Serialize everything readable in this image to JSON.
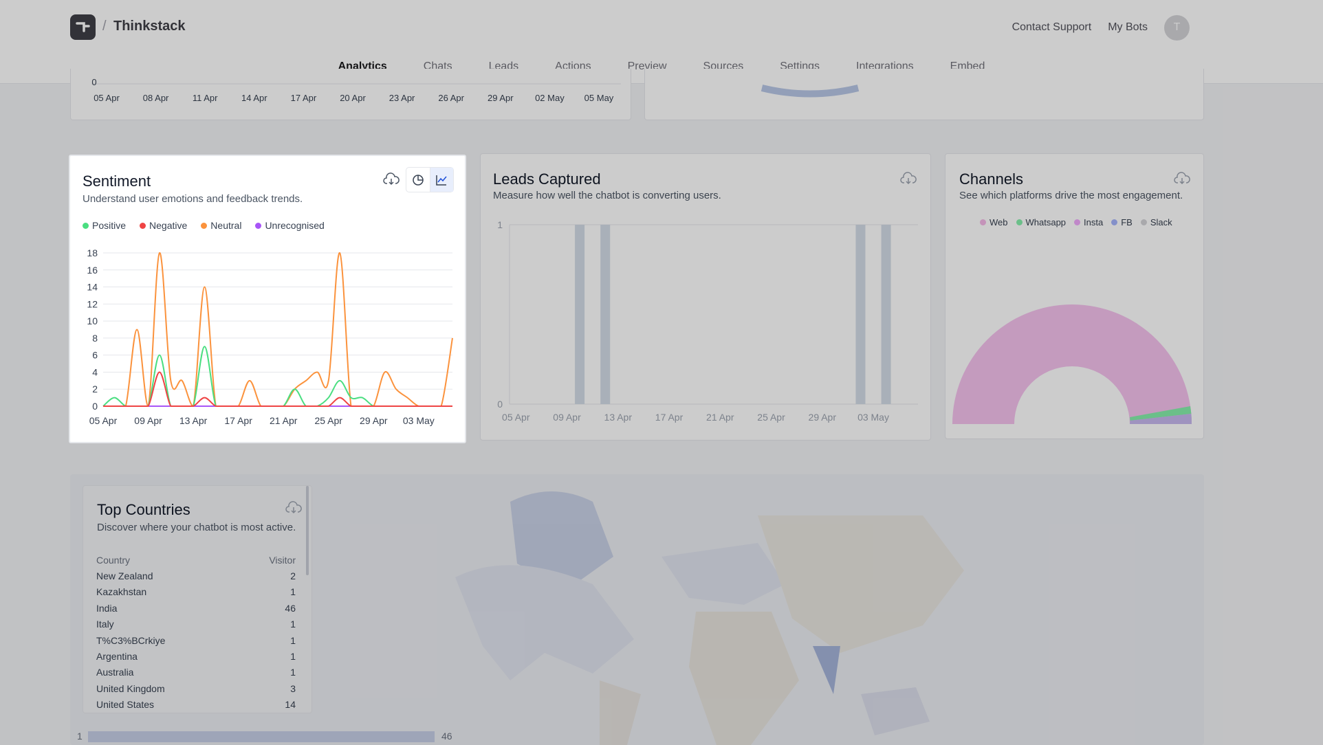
{
  "header": {
    "brand": "Thinkstack",
    "separator": "/",
    "contact_support": "Contact Support",
    "my_bots": "My Bots",
    "avatar_initial": "T"
  },
  "tabs": [
    {
      "label": "Analytics",
      "active": true
    },
    {
      "label": "Chats"
    },
    {
      "label": "Leads"
    },
    {
      "label": "Actions"
    },
    {
      "label": "Preview"
    },
    {
      "label": "Sources"
    },
    {
      "label": "Settings"
    },
    {
      "label": "Integrations"
    },
    {
      "label": "Embed"
    }
  ],
  "top_chart": {
    "y_zero": "0",
    "x_ticks": [
      "05 Apr",
      "08 Apr",
      "11 Apr",
      "14 Apr",
      "17 Apr",
      "20 Apr",
      "23 Apr",
      "26 Apr",
      "29 Apr",
      "02 May",
      "05 May"
    ]
  },
  "sentiment": {
    "title": "Sentiment",
    "subtitle": "Understand user emotions and feedback trends.",
    "legend": [
      {
        "label": "Positive",
        "color": "#4ade80"
      },
      {
        "label": "Negative",
        "color": "#ef4444"
      },
      {
        "label": "Neutral",
        "color": "#fb923c"
      },
      {
        "label": "Unrecognised",
        "color": "#a855f7"
      }
    ],
    "icons": {
      "download": "cloud-download-icon",
      "pie": "pie-chart-icon",
      "line": "line-chart-icon"
    }
  },
  "leads": {
    "title": "Leads Captured",
    "subtitle": "Measure how well the chatbot is converting users.",
    "y_ticks": [
      "0",
      "1"
    ],
    "x_ticks": [
      "05 Apr",
      "09 Apr",
      "13 Apr",
      "17 Apr",
      "21 Apr",
      "25 Apr",
      "29 Apr",
      "03 May"
    ],
    "bar_color": "#d4dde8",
    "bars": [
      {
        "date": "10 Apr",
        "value": 1
      },
      {
        "date": "12 Apr",
        "value": 1
      },
      {
        "date": "02 May",
        "value": 1
      },
      {
        "date": "04 May",
        "value": 1
      }
    ]
  },
  "channels": {
    "title": "Channels",
    "subtitle": "See which platforms drive the most engagement.",
    "legend": [
      {
        "label": "Web",
        "color": "#f5b8e8"
      },
      {
        "label": "Whatsapp",
        "color": "#86efac"
      },
      {
        "label": "Insta",
        "color": "#f0abfc"
      },
      {
        "label": "FB",
        "color": "#a5b4fc"
      },
      {
        "label": "Slack",
        "color": "#d4d4d8"
      }
    ]
  },
  "countries": {
    "title": "Top Countries",
    "subtitle": "Discover where your chatbot is most active.",
    "col_country": "Country",
    "col_visitor": "Visitor",
    "rows": [
      {
        "country": "New Zealand",
        "visitors": "2"
      },
      {
        "country": "Kazakhstan",
        "visitors": "1"
      },
      {
        "country": "India",
        "visitors": "46"
      },
      {
        "country": "Italy",
        "visitors": "1"
      },
      {
        "country": "T%C3%BCrkiye",
        "visitors": "1"
      },
      {
        "country": "Argentina",
        "visitors": "1"
      },
      {
        "country": "Australia",
        "visitors": "1"
      },
      {
        "country": "United Kingdom",
        "visitors": "3"
      },
      {
        "country": "United States",
        "visitors": "14"
      }
    ],
    "scale_min": "1",
    "scale_max": "46"
  },
  "chart_data": {
    "type": "line",
    "title": "Sentiment",
    "x": [
      "05 Apr",
      "06 Apr",
      "07 Apr",
      "08 Apr",
      "09 Apr",
      "10 Apr",
      "11 Apr",
      "12 Apr",
      "13 Apr",
      "14 Apr",
      "15 Apr",
      "16 Apr",
      "17 Apr",
      "18 Apr",
      "19 Apr",
      "20 Apr",
      "21 Apr",
      "22 Apr",
      "23 Apr",
      "24 Apr",
      "25 Apr",
      "26 Apr",
      "27 Apr",
      "28 Apr",
      "29 Apr",
      "30 Apr",
      "01 May",
      "02 May",
      "03 May",
      "04 May",
      "05 May",
      "06 May"
    ],
    "x_ticks": [
      "05 Apr",
      "09 Apr",
      "13 Apr",
      "17 Apr",
      "21 Apr",
      "25 Apr",
      "29 Apr",
      "03 May"
    ],
    "y_ticks": [
      0,
      2,
      4,
      6,
      8,
      10,
      12,
      14,
      16,
      18
    ],
    "ylim": [
      0,
      18
    ],
    "grid": true,
    "legend_position": "top-left",
    "series": [
      {
        "name": "Positive",
        "color": "#4ade80",
        "values": [
          0,
          1,
          0,
          0,
          0,
          6,
          0,
          0,
          0,
          7,
          0,
          0,
          0,
          0,
          0,
          0,
          0,
          2,
          0,
          0,
          1,
          3,
          1,
          1,
          0,
          0,
          0,
          0,
          0,
          0,
          0,
          0
        ]
      },
      {
        "name": "Negative",
        "color": "#ef4444",
        "values": [
          0,
          0,
          0,
          0,
          0,
          4,
          0,
          0,
          0,
          1,
          0,
          0,
          0,
          0,
          0,
          0,
          0,
          0,
          0,
          0,
          0,
          1,
          0,
          0,
          0,
          0,
          0,
          0,
          0,
          0,
          0,
          0
        ]
      },
      {
        "name": "Neutral",
        "color": "#fb923c",
        "values": [
          0,
          0,
          0,
          9,
          0,
          18,
          3,
          3,
          0,
          14,
          0,
          0,
          0,
          3,
          0,
          0,
          0,
          2,
          3,
          4,
          3,
          18,
          0,
          0,
          0,
          4,
          2,
          1,
          0,
          0,
          0,
          8
        ]
      },
      {
        "name": "Unrecognised",
        "color": "#a855f7",
        "values": [
          0,
          0,
          0,
          0,
          0,
          0,
          0,
          0,
          0,
          0,
          0,
          0,
          0,
          0,
          0,
          0,
          0,
          0,
          0,
          0,
          0,
          0,
          0,
          0,
          0,
          0,
          0,
          0,
          0,
          0,
          0,
          0
        ]
      }
    ]
  }
}
